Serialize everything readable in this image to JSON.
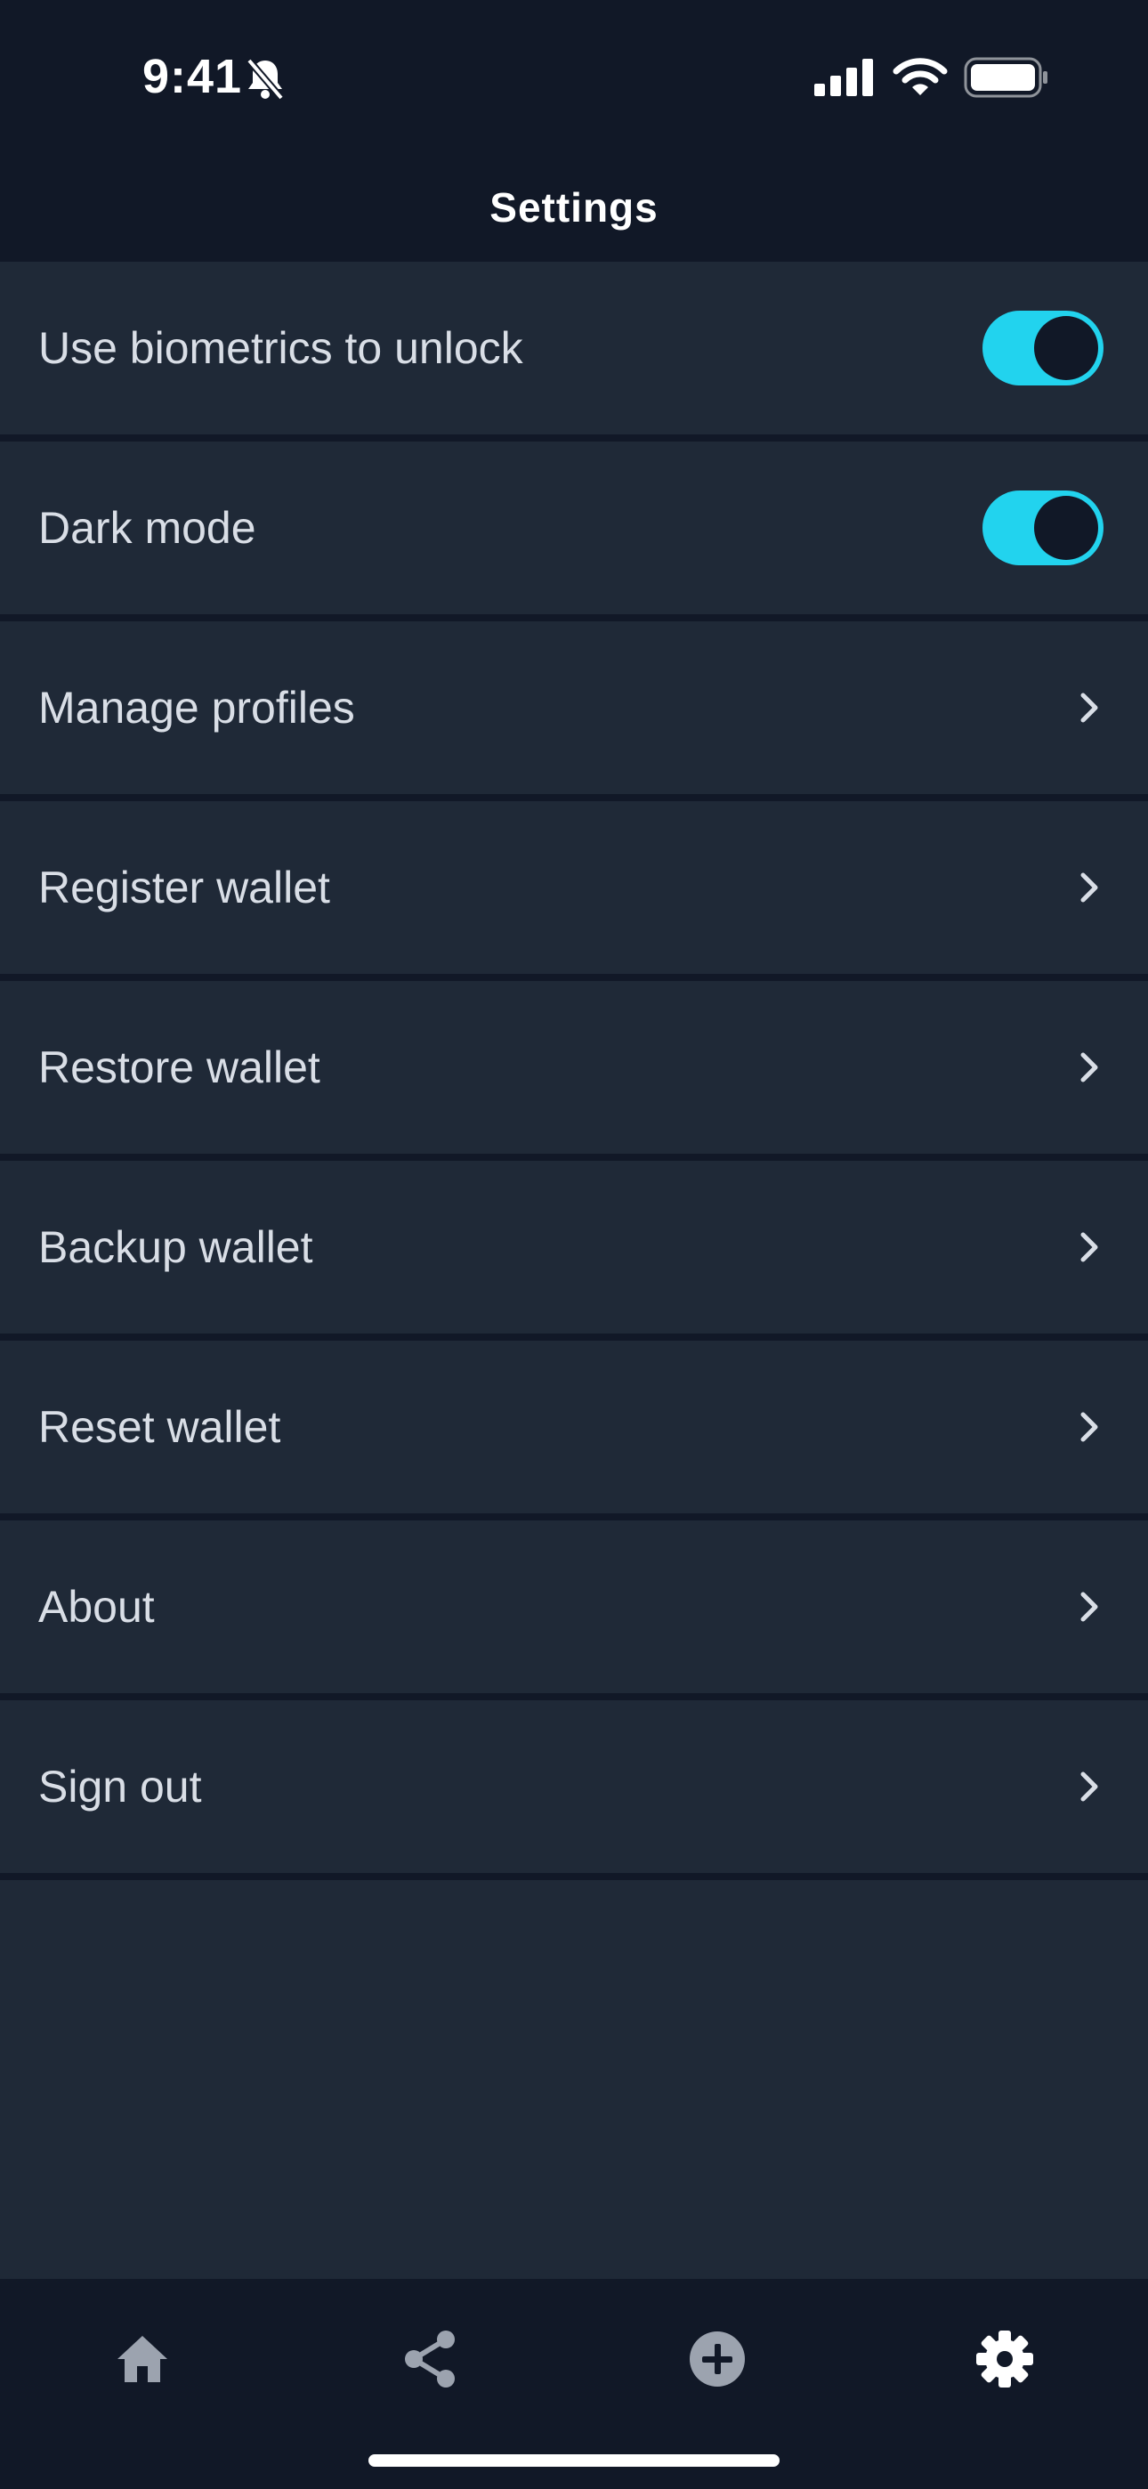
{
  "status_bar": {
    "time": "9:41"
  },
  "header": {
    "title": "Settings"
  },
  "settings": {
    "items": [
      {
        "label": "Use biometrics to unlock",
        "control": "toggle",
        "enabled": true
      },
      {
        "label": "Dark mode",
        "control": "toggle",
        "enabled": true
      },
      {
        "label": "Manage profiles",
        "control": "chevron"
      },
      {
        "label": "Register wallet",
        "control": "chevron"
      },
      {
        "label": "Restore wallet",
        "control": "chevron"
      },
      {
        "label": "Backup wallet",
        "control": "chevron"
      },
      {
        "label": "Reset wallet",
        "control": "chevron"
      },
      {
        "label": "About",
        "control": "chevron"
      },
      {
        "label": "Sign out",
        "control": "chevron"
      }
    ]
  },
  "tab_bar": {
    "tabs": [
      {
        "icon": "home-icon",
        "active": false
      },
      {
        "icon": "share-icon",
        "active": false
      },
      {
        "icon": "add-circle-icon",
        "active": false
      },
      {
        "icon": "gear-icon",
        "active": true
      }
    ]
  },
  "colors": {
    "background": "#1f2937",
    "bar_background": "#111827",
    "accent": "#22d3ee",
    "text": "#d9dee6",
    "inactive_icon": "#9ca3af",
    "active_icon": "#ffffff"
  }
}
